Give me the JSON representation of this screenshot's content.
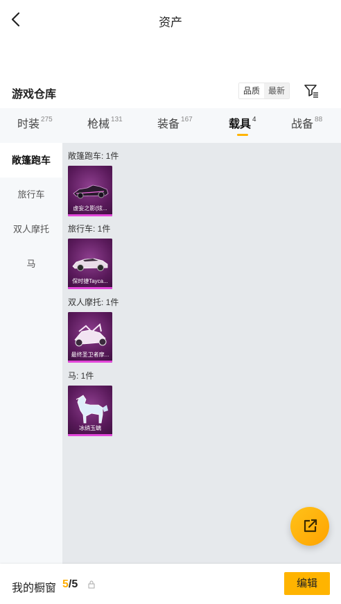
{
  "header": {
    "title": "资产"
  },
  "section": {
    "title": "游戏仓库",
    "sort_options": [
      "品质",
      "最新"
    ]
  },
  "tabs": [
    {
      "label": "时装",
      "count": "275"
    },
    {
      "label": "枪械",
      "count": "131"
    },
    {
      "label": "装备",
      "count": "167"
    },
    {
      "label": "载具",
      "count": "4",
      "active": true
    },
    {
      "label": "战备",
      "count": "88"
    }
  ],
  "sidebar": {
    "items": [
      {
        "label": "敞篷跑车",
        "active": true
      },
      {
        "label": "旅行车"
      },
      {
        "label": "双人摩托"
      },
      {
        "label": "马"
      }
    ]
  },
  "groups": [
    {
      "label": "敞篷跑车: 1件",
      "items": [
        {
          "name": "虚妄之影(炫...",
          "icon": "convertible-car-icon"
        }
      ]
    },
    {
      "label": "旅行车: 1件",
      "items": [
        {
          "name": "保时捷Tayca...",
          "icon": "porsche-car-icon"
        }
      ]
    },
    {
      "label": "双人摩托: 1件",
      "items": [
        {
          "name": "最终圣卫者摩...",
          "icon": "motorcycle-icon"
        }
      ]
    },
    {
      "label": "马: 1件",
      "items": [
        {
          "name": "冰绡玉螭",
          "icon": "horse-icon"
        }
      ]
    }
  ],
  "footer": {
    "showcase_label": "我的橱窗",
    "showcase_current": "5",
    "showcase_sep": "/",
    "showcase_total": "5",
    "edit_label": "编辑"
  },
  "colors": {
    "accent": "#ffb400",
    "rarity_bar": "#e246d9",
    "card_bg": "#5b1a5c"
  }
}
